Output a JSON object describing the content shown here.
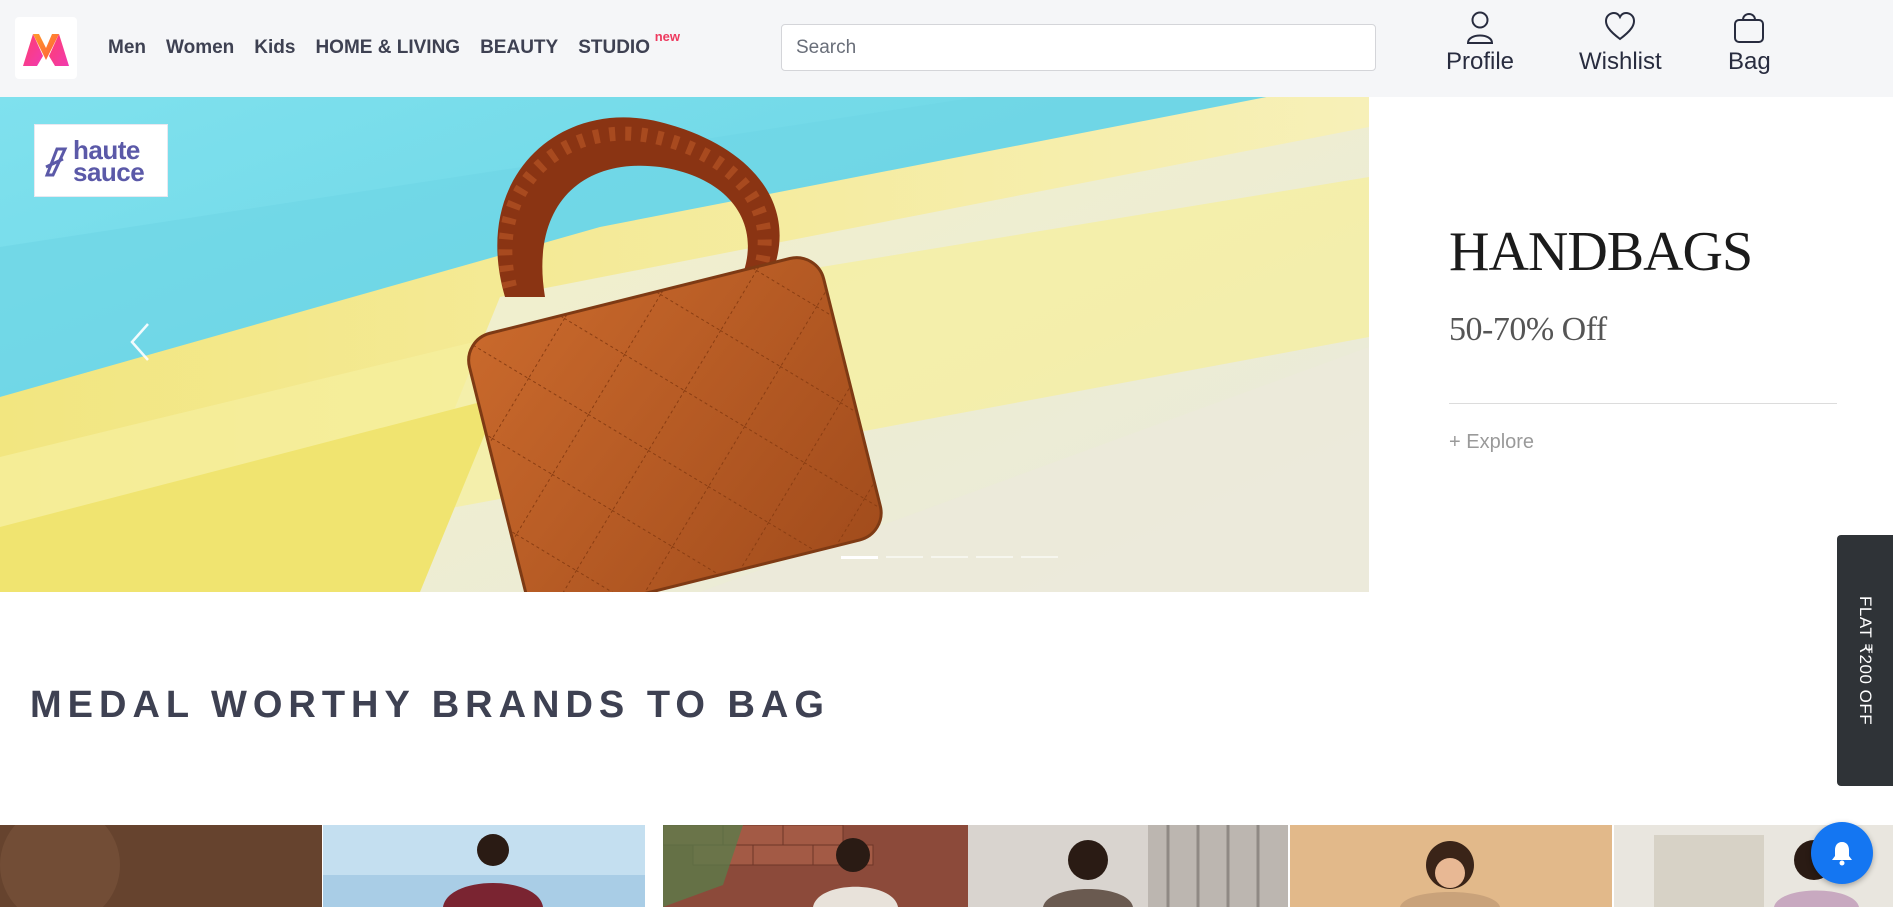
{
  "header": {
    "logo_icon": "myntra-logo-icon",
    "nav": [
      {
        "label": "Men"
      },
      {
        "label": "Women"
      },
      {
        "label": "Kids"
      },
      {
        "label": "HOME & LIVING"
      },
      {
        "label": "BEAUTY"
      },
      {
        "label": "STUDIO",
        "badge": "new"
      }
    ],
    "search": {
      "placeholder": "Search",
      "value": ""
    },
    "actions": [
      {
        "label": "Profile",
        "icon": "profile-icon"
      },
      {
        "label": "Wishlist",
        "icon": "heart-icon"
      },
      {
        "label": "Bag",
        "icon": "bag-icon"
      }
    ]
  },
  "banner": {
    "brand_logo": {
      "line1": "haute",
      "line2": "sauce"
    },
    "slide_count": 5,
    "active_slide": 1
  },
  "promo": {
    "title": "HANDBAGS",
    "offer": "50-70% Off",
    "cta": "+ Explore"
  },
  "side_tab": {
    "label": "FLAT ₹200 OFF"
  },
  "section": {
    "heading": "MEDAL WORTHY BRANDS TO BAG"
  },
  "colors": {
    "accent": "#ee3a5f",
    "header_bg": "#f5f6f8",
    "text_dark": "#282c3f",
    "side_tab_bg": "#2f3337",
    "bell_bg": "#1476f2"
  }
}
